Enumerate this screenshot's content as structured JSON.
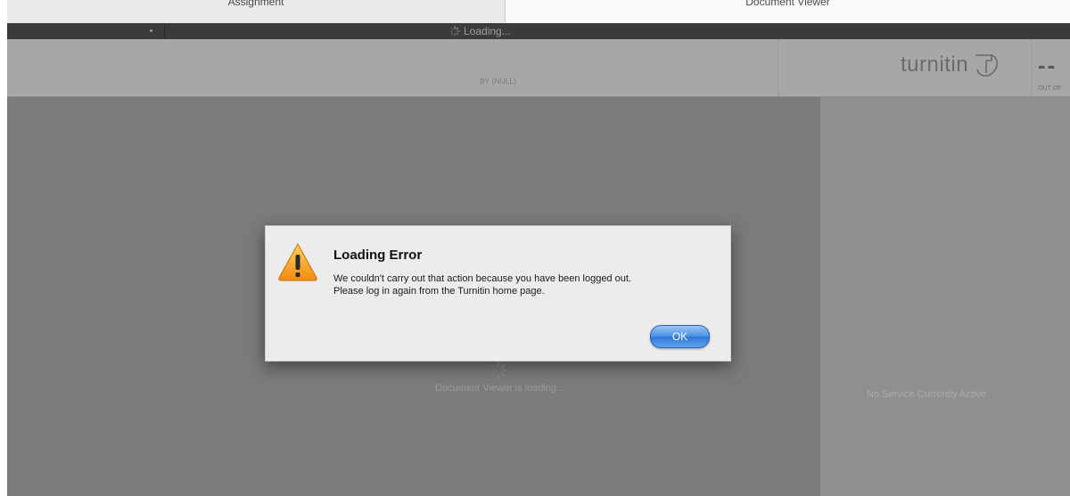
{
  "tabs": {
    "assignment": "Assignment",
    "document_viewer": "Document Viewer"
  },
  "loading_bar": {
    "status": "Loading..."
  },
  "header": {
    "byline": "BY (NULL)",
    "logo_text": "turnitin",
    "score": "--",
    "score_caption": "OUT OF"
  },
  "viewer": {
    "loading_text": "Document Viewer is loading..."
  },
  "side_panel": {
    "status": "No Service Currently Active"
  },
  "dialog": {
    "title": "Loading Error",
    "message_line1": "We couldn't carry out that action because you have been logged out.",
    "message_line2": "Please log in again from the Turnitin home page.",
    "ok_label": "OK"
  },
  "icons": {
    "warning": "warning-triangle-icon",
    "spinner": "spinner-icon",
    "logo": "turnitin-logo-icon"
  },
  "colors": {
    "ok_button": "#3a82dd",
    "warning": "#f39a1a"
  }
}
